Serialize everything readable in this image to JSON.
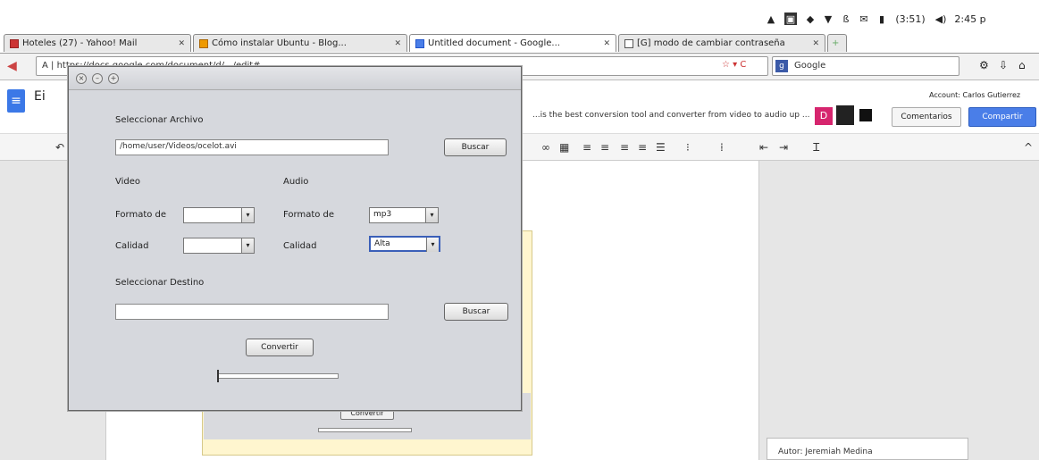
{
  "system_bar": {
    "time": "2:45 p",
    "clock": "(3:51)"
  },
  "tabs": [
    {
      "label": "Hoteles (27) - Yahoo! Mail"
    },
    {
      "label": "Cómo instalar Ubuntu - Blog..."
    },
    {
      "label": "Untitled document - Google..."
    },
    {
      "label": "[G] modo de cambiar contraseña"
    }
  ],
  "nav": {
    "url": "A | https://docs.google.com/document/d/.../edit#",
    "search_placeholder": "Google"
  },
  "docs": {
    "title": "Ei",
    "notice": "...is the best conversion tool and converter from video to audio up ...",
    "signin": "Account: Carlos Gutierrez",
    "comments_label": "Comentarios",
    "share_label": "Compartir",
    "comment_text": "Autor: Jeremiah Medina"
  },
  "dialog": {
    "select_file_label": "Seleccionar Archivo",
    "file_path": "/home/user/Videos/ocelot.avi",
    "browse_label": "Buscar",
    "video_label": "Video",
    "audio_label": "Audio",
    "video_format_label": "Formato de",
    "video_format_value": "",
    "video_quality_label": "Calidad",
    "video_quality_value": "",
    "audio_format_label": "Formato de",
    "audio_format_value": "mp3",
    "audio_quality_label": "Calidad",
    "audio_quality_value": "Alta",
    "destination_label": "Seleccionar Destino",
    "destination_value": "",
    "destination_button": "Buscar",
    "convert_label": "Convertir",
    "progress": 0
  },
  "background_dialog": {
    "button_label": "Convertir"
  }
}
